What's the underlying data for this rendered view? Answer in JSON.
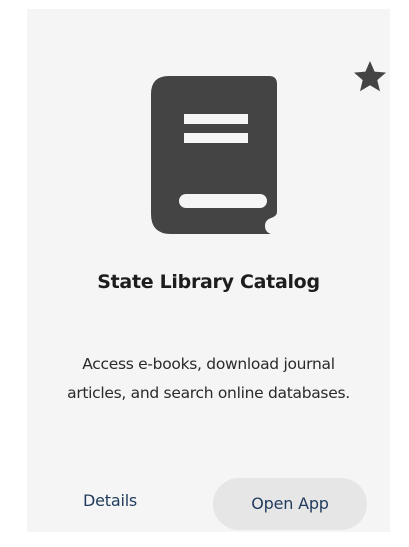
{
  "card": {
    "title": "State Library Catalog",
    "description": "Access e-books, download journal articles, and search online databases.",
    "icon": "book-icon",
    "favorite_icon": "star-icon",
    "actions": {
      "details_label": "Details",
      "open_label": "Open App"
    }
  },
  "colors": {
    "icon": "#444444",
    "link": "#1f3a5c",
    "card_background": "#f5f5f5",
    "button_background": "#e6e6e6"
  }
}
